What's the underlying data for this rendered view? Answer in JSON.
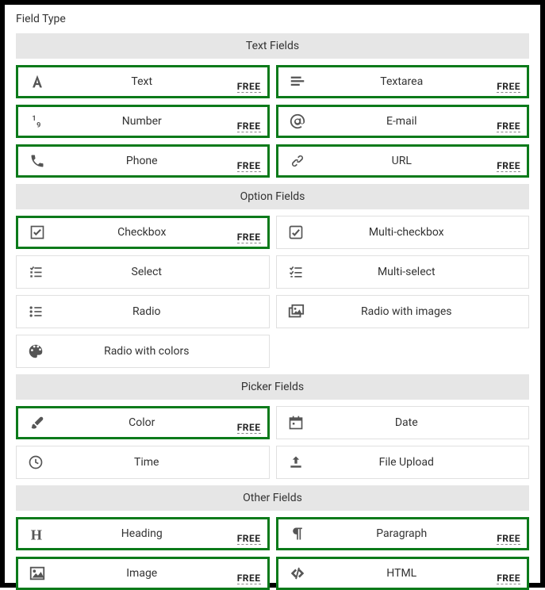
{
  "title": "Field Type",
  "badge_text": "FREE",
  "groups": [
    {
      "header": "Text Fields",
      "items": [
        {
          "id": "text",
          "label": "Text",
          "icon": "font-icon",
          "selected": true,
          "free": true
        },
        {
          "id": "textarea",
          "label": "Textarea",
          "icon": "align-left-icon",
          "selected": true,
          "free": true
        },
        {
          "id": "number",
          "label": "Number",
          "icon": "number-icon",
          "selected": true,
          "free": true
        },
        {
          "id": "email",
          "label": "E-mail",
          "icon": "at-icon",
          "selected": true,
          "free": true
        },
        {
          "id": "phone",
          "label": "Phone",
          "icon": "phone-icon",
          "selected": true,
          "free": true
        },
        {
          "id": "url",
          "label": "URL",
          "icon": "link-icon",
          "selected": true,
          "free": true
        }
      ]
    },
    {
      "header": "Option Fields",
      "items": [
        {
          "id": "checkbox",
          "label": "Checkbox",
          "icon": "check-square-icon",
          "selected": true,
          "free": true
        },
        {
          "id": "multi-checkbox",
          "label": "Multi-checkbox",
          "icon": "check-square-alt-icon",
          "selected": false,
          "free": false
        },
        {
          "id": "select",
          "label": "Select",
          "icon": "list-check-icon",
          "selected": false,
          "free": false
        },
        {
          "id": "multi-select",
          "label": "Multi-select",
          "icon": "list-check-alt-icon",
          "selected": false,
          "free": false
        },
        {
          "id": "radio",
          "label": "Radio",
          "icon": "list-ul-icon",
          "selected": false,
          "free": false
        },
        {
          "id": "radio-images",
          "label": "Radio with images",
          "icon": "images-icon",
          "selected": false,
          "free": false
        },
        {
          "id": "radio-colors",
          "label": "Radio with colors",
          "icon": "palette-icon",
          "selected": false,
          "free": false
        }
      ]
    },
    {
      "header": "Picker Fields",
      "items": [
        {
          "id": "color",
          "label": "Color",
          "icon": "brush-icon",
          "selected": true,
          "free": true
        },
        {
          "id": "date",
          "label": "Date",
          "icon": "calendar-icon",
          "selected": false,
          "free": false
        },
        {
          "id": "time",
          "label": "Time",
          "icon": "clock-icon",
          "selected": false,
          "free": false
        },
        {
          "id": "file",
          "label": "File Upload",
          "icon": "upload-icon",
          "selected": false,
          "free": false
        }
      ]
    },
    {
      "header": "Other Fields",
      "items": [
        {
          "id": "heading",
          "label": "Heading",
          "icon": "heading-icon",
          "selected": true,
          "free": true
        },
        {
          "id": "paragraph",
          "label": "Paragraph",
          "icon": "paragraph-icon",
          "selected": true,
          "free": true
        },
        {
          "id": "image",
          "label": "Image",
          "icon": "image-icon",
          "selected": true,
          "free": true
        },
        {
          "id": "html",
          "label": "HTML",
          "icon": "code-icon",
          "selected": true,
          "free": true
        }
      ]
    }
  ]
}
